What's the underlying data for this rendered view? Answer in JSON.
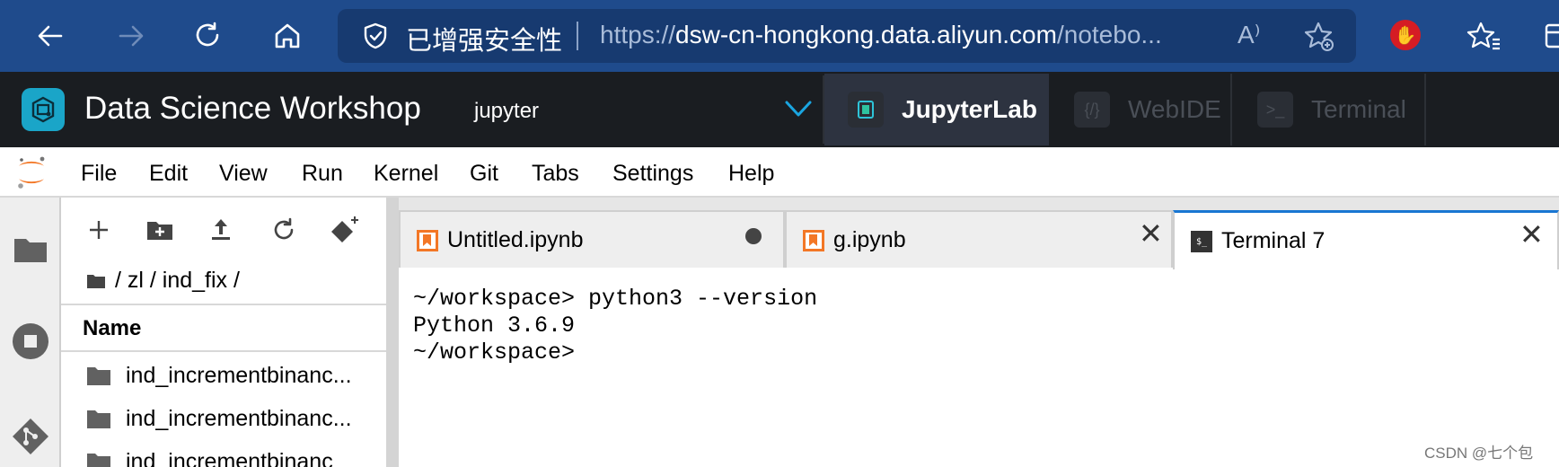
{
  "browser": {
    "security_label": "已增强安全性",
    "url_protocol": "https://",
    "url_host": "dsw-cn-hongkong.data.aliyun.com",
    "url_path": "/notebo...",
    "read_aloud_glyph": "A⁾"
  },
  "dsw": {
    "title": "Data Science Workshop",
    "environment_value": "jupyter",
    "tabs": [
      {
        "label": "JupyterLab",
        "active": true
      },
      {
        "label": "WebIDE",
        "icon_text": "{/}",
        "active": false
      },
      {
        "label": "Terminal",
        "icon_text": ">_",
        "active": false
      }
    ]
  },
  "menu": {
    "items": [
      "File",
      "Edit",
      "View",
      "Run",
      "Kernel",
      "Git",
      "Tabs",
      "Settings",
      "Help"
    ]
  },
  "filebrowser": {
    "breadcrumb": "/ zl / ind_fix /",
    "column_name": "Name",
    "items": [
      "ind_incrementbinanc...",
      "ind_incrementbinanc...",
      "ind_incrementbinanc"
    ]
  },
  "doc_tabs": [
    {
      "title": "Untitled.ipynb",
      "kind": "notebook",
      "state": "unsaved"
    },
    {
      "title": "g.ipynb",
      "kind": "notebook",
      "close": "✕"
    },
    {
      "title": "Terminal 7",
      "kind": "terminal",
      "active": true,
      "close": "✕",
      "icon_text": "$_"
    }
  ],
  "terminal": {
    "lines": [
      "~/workspace> python3 --version",
      "Python 3.6.9",
      "~/workspace>"
    ]
  },
  "watermark": "CSDN @七个包",
  "colors": {
    "browser_bar": "#1f4b8c",
    "dsw_header": "#1a1d21",
    "notebook_orange": "#f37726",
    "active_tab_accent": "#1976d2",
    "adblock_red": "#d51c24"
  }
}
